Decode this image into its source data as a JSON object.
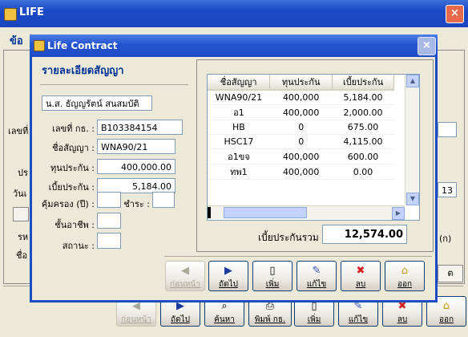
{
  "main": {
    "title": "LIFE",
    "close_glyph": "×",
    "partial_labels": {
      "group_title": "ข้อ",
      "label_a": "เลขที่",
      "label_b": "ปร",
      "label_c": "วันเ",
      "label_d": "รห",
      "label_e": "ชื่อ",
      "right_value": "13",
      "right_label": "(ก)",
      "right_btn": "ต"
    },
    "toolbar": {
      "prev": "ก่อนหน้า",
      "next": "ถัดไป",
      "search": "ค้นหา",
      "print": "พิมพ์ กธ.",
      "add": "เพิ่ม",
      "edit": "แก้ไข",
      "delete": "ลบ",
      "exit": "ออก"
    }
  },
  "dialog": {
    "title": "Life Contract",
    "close_glyph": "×",
    "section_title": "รายละเอียดสัญญา",
    "name": "น.ส. ธัญญรัตน์ สนสมบัติ",
    "fields": {
      "policy_no_label": "เลขที่ กธ. :",
      "policy_no": "B103384154",
      "contract_name_label": "ชื่อสัญญา :",
      "contract_name": "WNA90/21",
      "sum_insured_label": "ทุนประกัน :",
      "sum_insured": "400,000.00",
      "premium_label": "เบี้ยประกัน :",
      "premium": "5,184.00",
      "coverage_label": "คุ้มครอง (ปี) :",
      "coverage": "",
      "pay_label": "ชำระ :",
      "pay": "",
      "occupation_label": "ชั้นอาชีพ :",
      "occupation": "",
      "status_label": "สถานะ :",
      "status": ""
    },
    "table": {
      "headers": [
        "ชื่อสัญญา",
        "ทุนประกัน",
        "เบี้ยประกัน"
      ],
      "rows": [
        [
          "WNA90/21",
          "400,000",
          "5,184.00"
        ],
        [
          "อ1",
          "400,000",
          "2,000.00"
        ],
        [
          "HB",
          "0",
          "675.00"
        ],
        [
          "HSC17",
          "0",
          "4,115.00"
        ],
        [
          "อ1ขจ",
          "400,000",
          "600.00"
        ],
        [
          "ทพ1",
          "400,000",
          "0.00"
        ]
      ]
    },
    "total_label": "เบี้ยประกันรวม",
    "total_value": "12,574.00",
    "toolbar": {
      "prev": "ก่อนหน้า",
      "next": "ถัดไป",
      "add": "เพิ่ม",
      "edit": "แก้ไข",
      "delete": "ลบ",
      "exit": "ออก"
    }
  }
}
